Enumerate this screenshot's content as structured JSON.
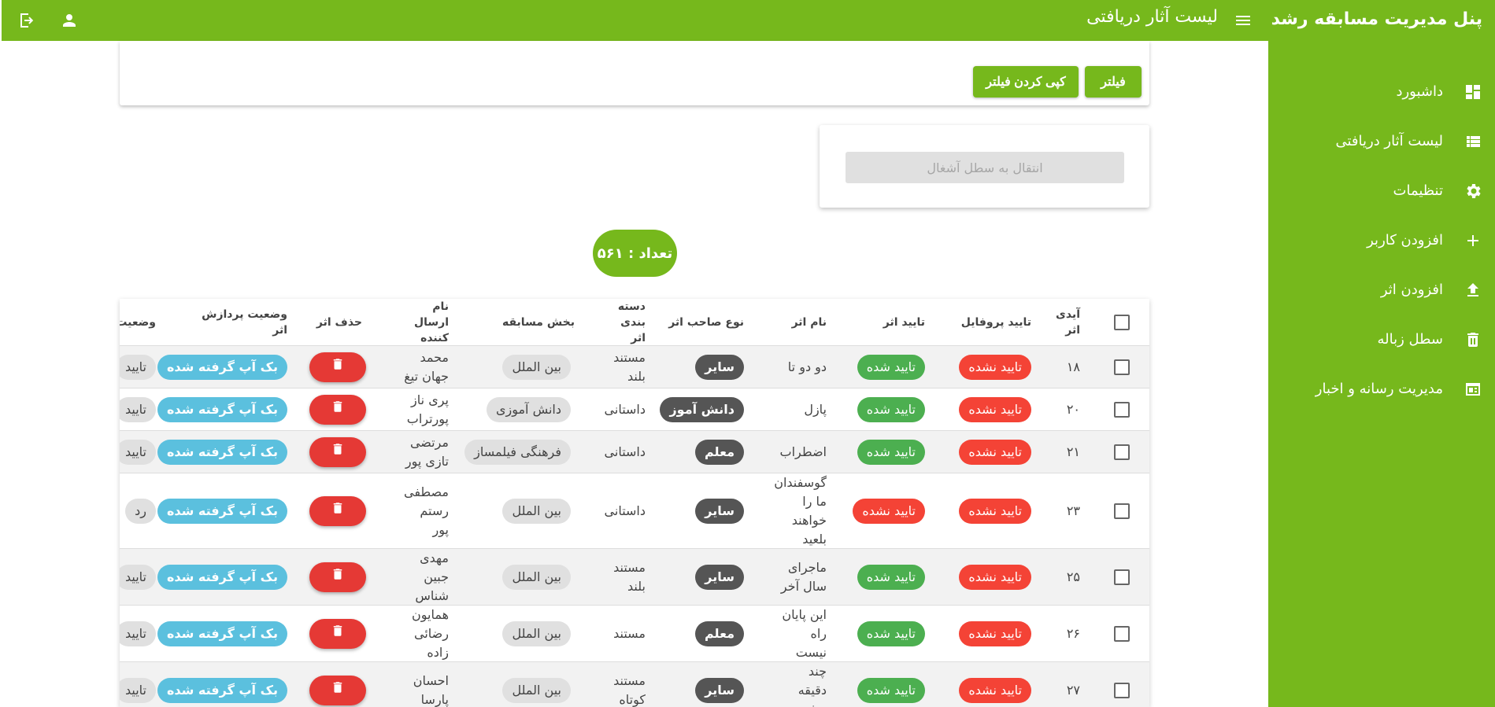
{
  "sidebar": {
    "title": "پنل مدیریت مسابقه رشد",
    "items": [
      {
        "label": "داشبورد",
        "icon": "dashboard-icon"
      },
      {
        "label": "لیست آثار دریافتی",
        "icon": "list-icon"
      },
      {
        "label": "تنظیمات",
        "icon": "gear-icon"
      },
      {
        "label": "افزودن کاربر",
        "icon": "plus-icon"
      },
      {
        "label": "افزودن اثر",
        "icon": "upload-icon"
      },
      {
        "label": "سطل زباله",
        "icon": "trash-icon"
      },
      {
        "label": "مدیریت رسانه و اخبار",
        "icon": "media-icon"
      }
    ]
  },
  "header": {
    "title": "لیست آثار دریافتی"
  },
  "filter": {
    "filter_label": "فیلتر",
    "copy_label": "کپی کردن فیلتر"
  },
  "archive": {
    "button_label": "انتقال به سطل آشغال"
  },
  "count": {
    "label": "تعداد : ۵۶۱"
  },
  "table": {
    "headers": {
      "id": "آیدی اثر",
      "profile_approval": "تایید پروفایل",
      "work_approval": "تایید اثر",
      "work_name": "نام اثر",
      "owner_type": "نوع صاحب اثر",
      "category": "دسته بندی اثر",
      "section": "بخش مسابقه",
      "sender": "نام ارسال کننده",
      "delete": "حذف اثر",
      "processing": "وضعیت پردازش اثر",
      "status": "وضعیت"
    },
    "rows": [
      {
        "id": "۱۸",
        "profile": "تایید نشده",
        "work": "تایید شده",
        "work_ok": true,
        "name": "دو دو تا",
        "owner": "سایر",
        "category": "مستند بلند",
        "section": "بین الملل",
        "sender": "محمد جهان تیغ",
        "processing": "بک آپ گرفته شده",
        "status": "تایید"
      },
      {
        "id": "۲۰",
        "profile": "تایید نشده",
        "work": "تایید شده",
        "work_ok": true,
        "name": "پازل",
        "owner": "دانش آموز",
        "category": "داستانی",
        "section": "دانش آموزی",
        "sender": "پری ناز پورتراب",
        "processing": "بک آپ گرفته شده",
        "status": "تایید"
      },
      {
        "id": "۲۱",
        "profile": "تایید نشده",
        "work": "تایید شده",
        "work_ok": true,
        "name": "اضطراب",
        "owner": "معلم",
        "category": "داستانی",
        "section": "فرهنگی فیلمساز",
        "sender": "مرتضی تازی پور",
        "processing": "بک آپ گرفته شده",
        "status": "تایید"
      },
      {
        "id": "۲۳",
        "profile": "تایید نشده",
        "work": "تایید نشده",
        "work_ok": false,
        "name": "گوسفندان ما را خواهند بلعید",
        "owner": "سایر",
        "category": "داستانی",
        "section": "بین الملل",
        "sender": "مصطفی رستم پور",
        "processing": "بک آپ گرفته شده",
        "status": "رد"
      },
      {
        "id": "۲۵",
        "profile": "تایید نشده",
        "work": "تایید شده",
        "work_ok": true,
        "name": "ماجرای سال آخر",
        "owner": "سایر",
        "category": "مستند بلند",
        "section": "بین الملل",
        "sender": "مهدی جبین شناس",
        "processing": "بک آپ گرفته شده",
        "status": "تایید"
      },
      {
        "id": "۲۶",
        "profile": "تایید نشده",
        "work": "تایید شده",
        "work_ok": true,
        "name": "این پایان راه نیست",
        "owner": "معلم",
        "category": "مستند",
        "section": "بین الملل",
        "sender": "همایون رضائی زاده",
        "processing": "بک آپ گرفته شده",
        "status": "تایید"
      },
      {
        "id": "۲۷",
        "profile": "تایید نشده",
        "work": "تایید شده",
        "work_ok": true,
        "name": "چند دقیقه بیشتر",
        "owner": "سایر",
        "category": "مستند کوتاه",
        "section": "بین الملل",
        "sender": "احسان پارسا",
        "processing": "بک آپ گرفته شده",
        "status": "تایید"
      }
    ]
  },
  "colors": {
    "brand": "#76b81c",
    "danger": "#f44336",
    "success": "#4caf50",
    "info": "#5bc0de"
  }
}
